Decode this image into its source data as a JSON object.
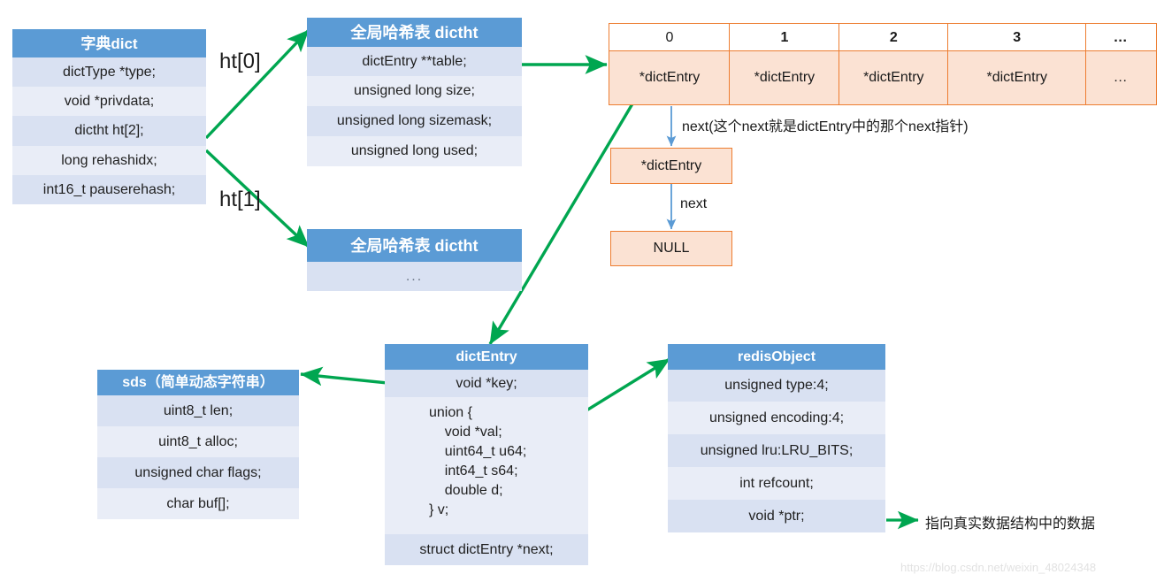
{
  "colors": {
    "header_blue": "#5b9bd5",
    "row_blue_dark": "#d9e1f2",
    "row_blue_light": "#e9edf7",
    "orange_border": "#ed7d31",
    "orange_fill": "#fbe2d3",
    "green_arrow": "#00a650",
    "blue_arrow": "#5b9bd5",
    "watermark": "#e2e2e2"
  },
  "dict_struct": {
    "title": "字典dict",
    "rows": [
      "dictType *type;",
      "void *privdata;",
      "dictht ht[2];",
      "long rehashidx;",
      "int16_t pauserehash;"
    ]
  },
  "dictht_primary": {
    "title": "全局哈希表 dictht",
    "rows": [
      "dictEntry **table;",
      "unsigned long size;",
      "unsigned long sizemask;",
      "unsigned long used;"
    ]
  },
  "dictht_secondary": {
    "title": "全局哈希表 dictht",
    "rows": [
      "..."
    ]
  },
  "hash_table": {
    "index_headers": [
      "0",
      "1",
      "2",
      "3",
      "…"
    ],
    "cells": [
      "*dictEntry",
      "*dictEntry",
      "*dictEntry",
      "*dictEntry",
      "…"
    ]
  },
  "bucket_chain": {
    "next_label_long": "next(这个next就是dictEntry中的那个next指针)",
    "node": "*dictEntry",
    "next_label": "next",
    "terminator": "NULL"
  },
  "dict_entry_struct": {
    "title": "dictEntry",
    "key_row": "void *key;",
    "union_row": "union {\n    void *val;\n    uint64_t u64;\n    int64_t s64;\n    double d;\n} v;",
    "next_row": "struct dictEntry *next;"
  },
  "sds_struct": {
    "title": "sds（简单动态字符串）",
    "rows": [
      "uint8_t len;",
      "uint8_t alloc;",
      "unsigned char flags;",
      "char buf[];"
    ]
  },
  "redis_object_struct": {
    "title": "redisObject",
    "rows": [
      "unsigned type:4;",
      "unsigned encoding:4;",
      "unsigned lru:LRU_BITS;",
      "int refcount;",
      "void *ptr;"
    ]
  },
  "edge_labels": {
    "ht0": "ht[0]",
    "ht1": "ht[1]",
    "ptr_target": "指向真实数据结构中的数据"
  },
  "watermark": "https://blog.csdn.net/weixin_48024348"
}
